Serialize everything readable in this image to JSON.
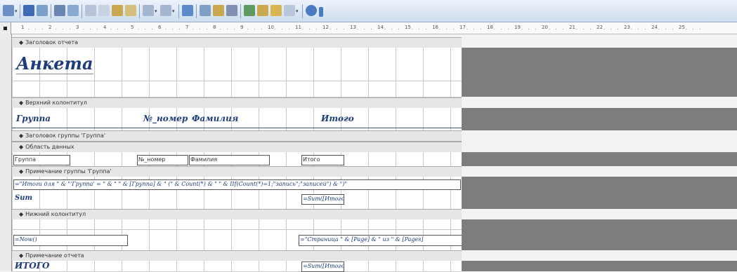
{
  "toolbar": {
    "icons": [
      "view-icon",
      "save-icon",
      "search-icon",
      "print-icon",
      "print-preview-icon",
      "cut-icon",
      "copy-icon",
      "paste-icon",
      "format-painter-icon",
      "undo-icon",
      "redo-icon",
      "field-list-icon",
      "toolbox-icon",
      "autoformat-icon",
      "code-icon",
      "properties-icon",
      "build-icon",
      "database-window-icon",
      "new-object-icon",
      "help-icon"
    ]
  },
  "ruler": {
    "numbers": [
      "1",
      "2",
      "3",
      "4",
      "5",
      "6",
      "7",
      "8",
      "9",
      "10",
      "11",
      "12",
      "13",
      "14",
      "15",
      "16",
      "17",
      "18",
      "19",
      "20",
      "21",
      "22",
      "23",
      "24",
      "25"
    ]
  },
  "sections": {
    "report_header": "Заголовок отчета",
    "page_header": "Верхний колонтитул",
    "group_header": "Заголовок группы 'Группа'",
    "detail": "Область данных",
    "group_footer": "Примечание группы 'Группа'",
    "page_footer": "Нижний колонтитул",
    "report_footer": "Примечание отчета"
  },
  "report_header": {
    "title": "Анкета"
  },
  "page_header": {
    "col_group": "Группа",
    "col_number": "№_номер",
    "col_surname": "Фамилия",
    "col_total": "Итого"
  },
  "detail": {
    "field_group": "Группа",
    "field_number": "№_номер",
    "field_surname": "Фамилия",
    "field_total": "Итого"
  },
  "group_footer": {
    "summary_expr": "=\"Итоги для \" & \"'Группа' = \" & \" \" & [Группа] & \" (\" & Count(*) & \" \" & IIf(Count(*)=1;\"запись\";\"записей\") & \")\"",
    "sum_label": "Sum",
    "sum_expr": "=Sum([Итого])"
  },
  "page_footer": {
    "now_expr": "=Now()",
    "page_expr": "=\"Страница \" & [Page] & \" из \" & [Pages]"
  },
  "report_footer": {
    "total_label": "ИТОГО",
    "total_expr": "=Sum([Итого])"
  }
}
